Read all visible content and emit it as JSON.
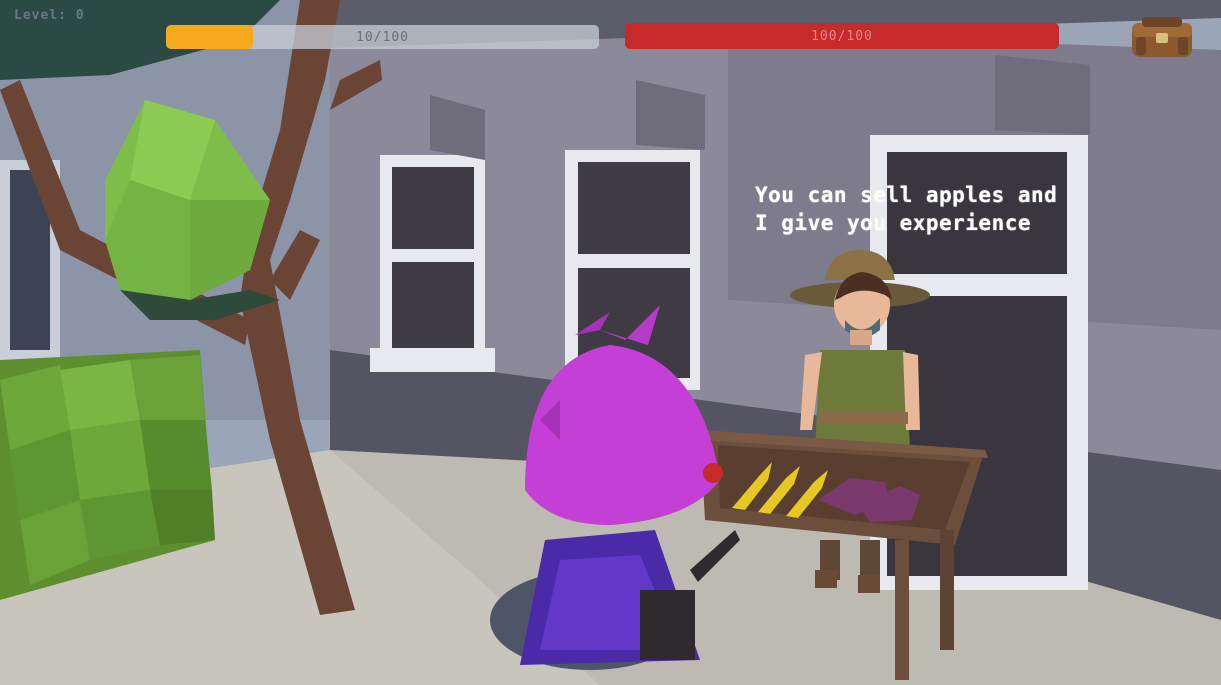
{
  "hud": {
    "level_text": "Level: 0",
    "xp_text": "10/100",
    "xp_fraction": 0.2,
    "hp_text": "100/100",
    "hp_fraction": 1.0
  },
  "inventory": {
    "icon": "backpack-icon"
  },
  "npc": {
    "dialogue_line1": "You can sell apples and",
    "dialogue_line2": "I give you experience"
  },
  "colors": {
    "xp_fill": "#f5a91d",
    "hp_fill": "#c72a2a",
    "player_hat": "#c43fd6",
    "player_cloak": "#4a2aa8"
  }
}
